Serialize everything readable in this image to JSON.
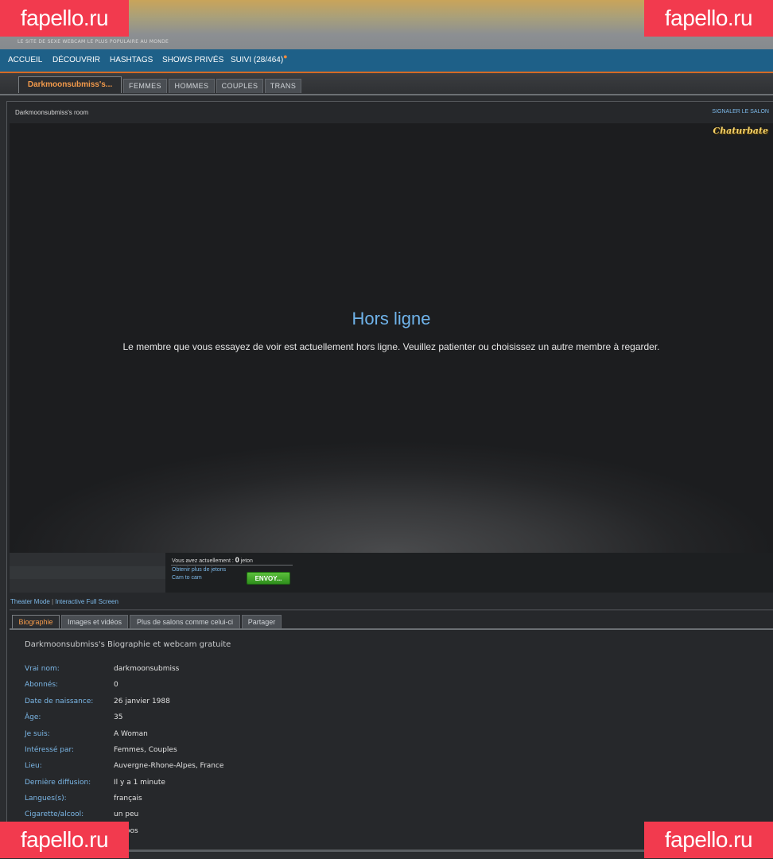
{
  "header": {
    "tagline": "LE SITE DE SEXE WEBCAM LE PLUS POPULAIRE AU MONDE"
  },
  "nav": {
    "items": [
      "ACCUEIL",
      "DÉCOUVRIR",
      "HASHTAGS",
      "SHOWS PRIVÉS",
      "SUIVI (28/464)"
    ],
    "dot": "●"
  },
  "tabs": [
    "Darkmoonsubmiss's...",
    "FEMMES",
    "HOMMES",
    "COUPLES",
    "TRANS"
  ],
  "room": {
    "title": "Darkmoonsubmiss's room",
    "report": "SIGNALER LE SALON",
    "logo": "Chaturbate"
  },
  "offline": {
    "title": "Hors ligne",
    "message": "Le membre que vous essayez de voir est actuellement hors ligne. Veuillez patienter ou choisissez un autre membre à regarder."
  },
  "tokens": {
    "prefix": "Vous avez actuellement :",
    "count": "0",
    "unit": "jeton",
    "get_more": "Obtenir plus de jetons",
    "cam_to_cam": "Cam to cam",
    "send": "ENVOY..."
  },
  "view_modes": {
    "theater": "Theater Mode",
    "separator": "|",
    "fullscreen": "Interactive Full Screen"
  },
  "bio_tabs": [
    "Biographie",
    "Images et vidéos",
    "Plus de salons comme celui-ci",
    "Partager"
  ],
  "bio": {
    "title": "Darkmoonsubmiss's Biographie et webcam gratuite",
    "rows": [
      {
        "label": "Vrai nom:",
        "value": "darkmoonsubmiss"
      },
      {
        "label": "Abonnés:",
        "value": "0"
      },
      {
        "label": "Date de naissance:",
        "value": "26 janvier 1988"
      },
      {
        "label": "Âge:",
        "value": "35"
      },
      {
        "label": "Je suis:",
        "value": "A Woman"
      },
      {
        "label": "Intéressé par:",
        "value": "Femmes, Couples"
      },
      {
        "label": "Lieu:",
        "value": "Auvergne-Rhone-Alpes, France"
      },
      {
        "label": "Dernière diffusion:",
        "value": "Il y a 1 minute"
      },
      {
        "label": "Langues(s):",
        "value": "français"
      },
      {
        "label": "Cigarette/alcool:",
        "value": "un peu"
      },
      {
        "label": "",
        "value": "oos"
      }
    ]
  },
  "watermark": "fapello.ru",
  "colors": {
    "nav_bg": "#1e6088",
    "accent_orange": "#f39a4b",
    "link_blue": "#7cb8e8",
    "send_green": "#3fa826",
    "watermark_red": "#f23a4e"
  }
}
